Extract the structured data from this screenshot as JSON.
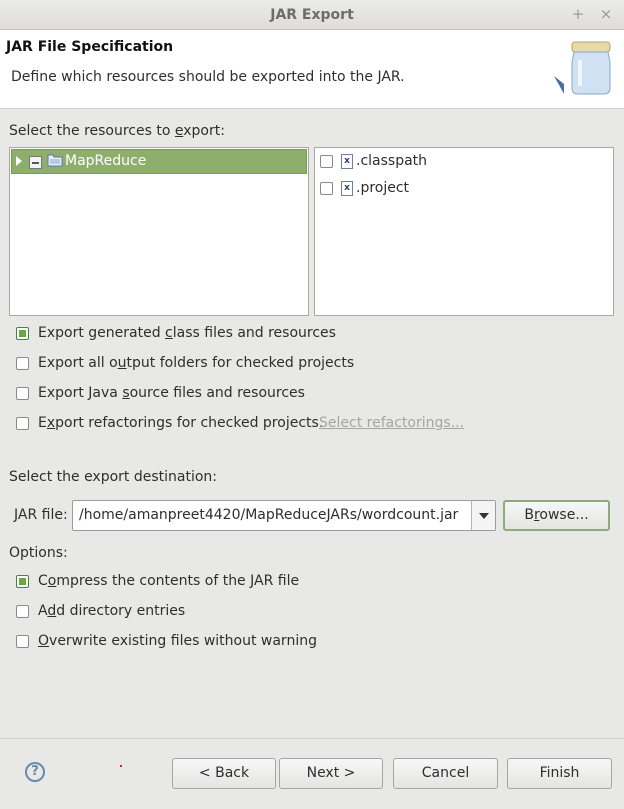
{
  "window": {
    "title": "JAR Export",
    "maximize_glyph": "+",
    "close_glyph": "×"
  },
  "header": {
    "title": "JAR File Specification",
    "description": "Define which resources should be exported into the JAR.",
    "icon": "jar-icon"
  },
  "resources": {
    "label_pre": "Select the resources to ",
    "label_mnemonic": "e",
    "label_post": "xport:",
    "tree": [
      {
        "name": "MapReduce",
        "expanded": false,
        "check_state": "partial",
        "selected": true
      }
    ],
    "files": [
      {
        "name": ".classpath",
        "checked": false
      },
      {
        "name": ".project",
        "checked": false
      }
    ]
  },
  "export_options": [
    {
      "pre": "Export generated ",
      "mn": "c",
      "post": "lass files and resources",
      "checked": true
    },
    {
      "pre": "Export all o",
      "mn": "u",
      "post": "tput folders for checked projects",
      "checked": false
    },
    {
      "pre": "Export Java ",
      "mn": "s",
      "post": "ource files and resources",
      "checked": false
    },
    {
      "pre": "E",
      "mn": "x",
      "post": "port refactorings for checked projects.",
      "checked": false
    }
  ],
  "select_refactorings_link": "Select refactorings...",
  "destination": {
    "label": "Select the export destination:",
    "jar_file_label": "JAR file:",
    "jar_file_value": "/home/amanpreet4420/MapReduceJARs/wordcount.jar",
    "browse_pre": "B",
    "browse_mn": "r",
    "browse_post": "owse..."
  },
  "options": {
    "label": "Options:",
    "items": [
      {
        "pre": "C",
        "mn": "o",
        "post": "mpress the contents of the JAR file",
        "checked": true
      },
      {
        "pre": "A",
        "mn": "d",
        "post": "d directory entries",
        "checked": false
      },
      {
        "pre": "",
        "mn": "O",
        "post": "verwrite existing files without warning",
        "checked": false
      }
    ]
  },
  "footer": {
    "help_glyph": "?",
    "back": "< Back",
    "next": "Next >",
    "cancel": "Cancel",
    "finish": "Finish"
  },
  "colors": {
    "selection": "#8eae6c",
    "check_fill": "#6ca64a",
    "focus_border": "#90a97b"
  }
}
